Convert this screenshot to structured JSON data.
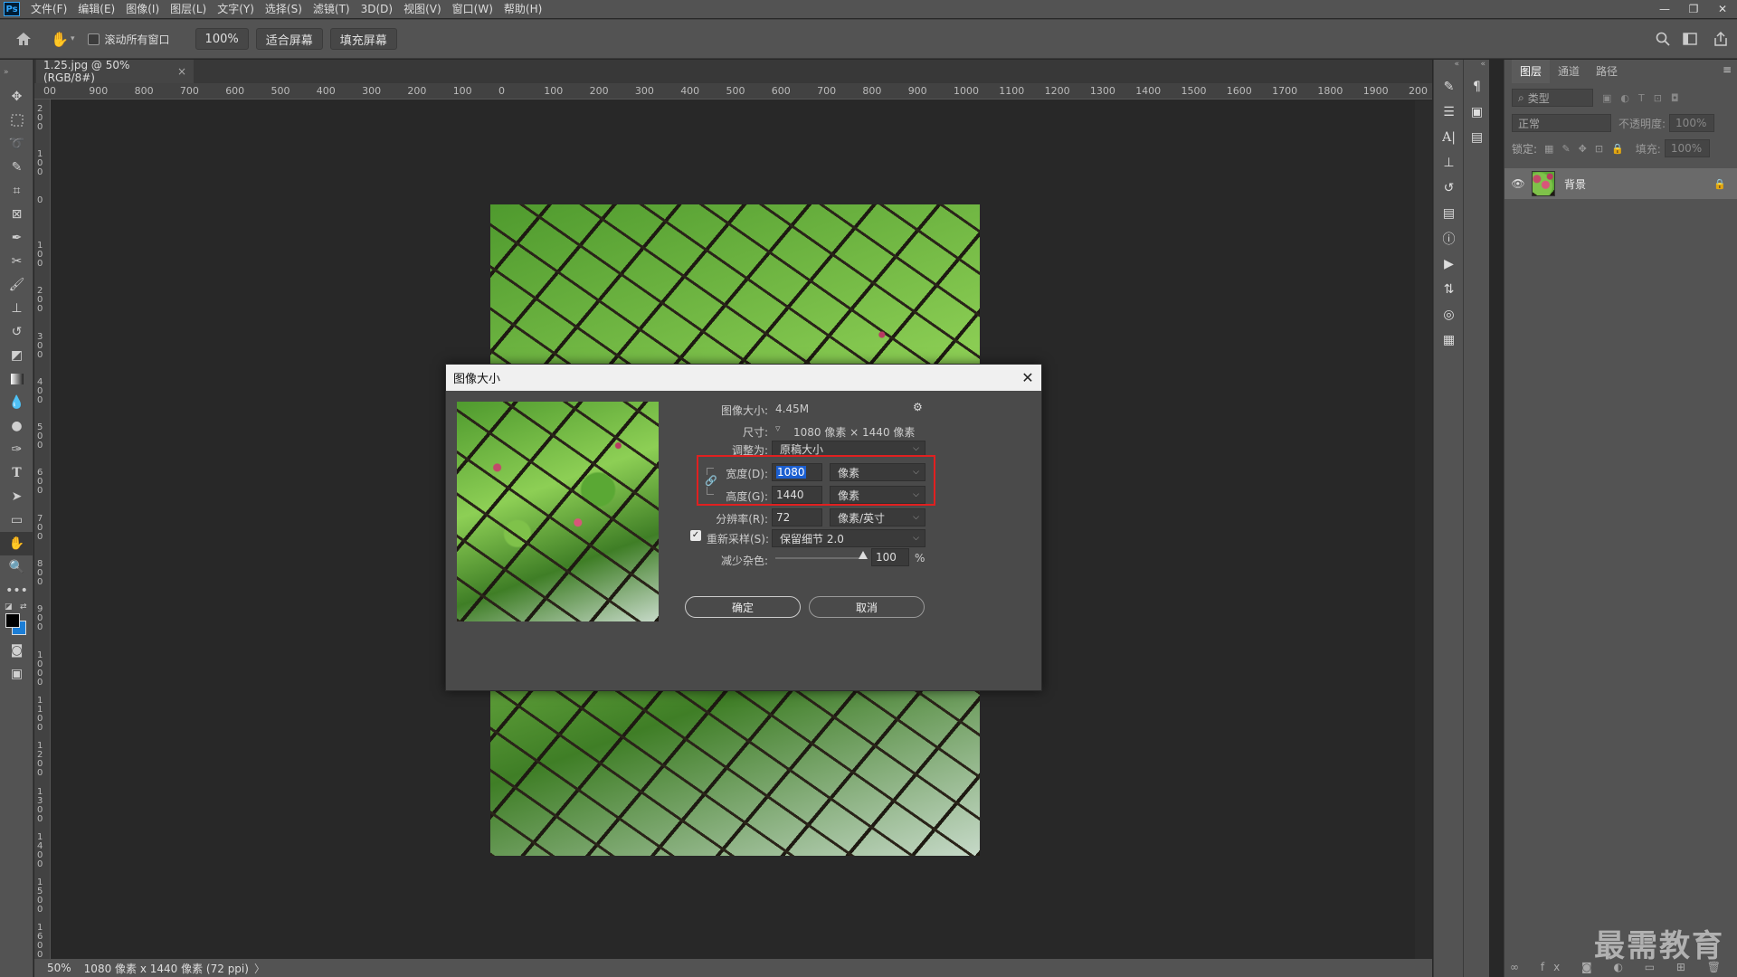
{
  "menubar": {
    "logo": "Ps",
    "items": [
      "文件(F)",
      "编辑(E)",
      "图像(I)",
      "图层(L)",
      "文字(Y)",
      "选择(S)",
      "滤镜(T)",
      "3D(D)",
      "视图(V)",
      "窗口(W)",
      "帮助(H)"
    ],
    "window_controls": [
      "—",
      "❐",
      "✕"
    ]
  },
  "options": {
    "scroll_all_label": "滚动所有窗口",
    "zoom_button": "100%",
    "fit_screen_button": "适合屏幕",
    "fill_screen_button": "填充屏幕"
  },
  "document": {
    "tab_title": "1.25.jpg @ 50%(RGB/8#)",
    "tab_close": "×"
  },
  "ruler": {
    "h_labels": [
      "00",
      "900",
      "800",
      "700",
      "600",
      "500",
      "400",
      "300",
      "200",
      "100",
      "0",
      "100",
      "200",
      "300",
      "400",
      "500",
      "600",
      "700",
      "800",
      "900",
      "1000",
      "1100",
      "1200",
      "1300",
      "1400",
      "1500",
      "1600",
      "1700",
      "1800",
      "1900",
      "200"
    ],
    "v_labels": [
      "200",
      "100",
      "0",
      "100",
      "200",
      "300",
      "400",
      "500",
      "600",
      "700",
      "800",
      "900",
      "1000",
      "1100",
      "1200",
      "1300",
      "1400",
      "1500",
      "1600"
    ]
  },
  "status": {
    "zoom": "50%",
    "doc_info": "1080 像素 x 1440 像素 (72 ppi)",
    "arrow": "〉"
  },
  "layers_panel": {
    "tabs": [
      "图层",
      "通道",
      "路径"
    ],
    "filter_placeholder": "类型",
    "blend_mode": "正常",
    "opacity_label": "不透明度:",
    "opacity_value": "100%",
    "lock_label": "锁定:",
    "fill_label": "填充:",
    "fill_value": "100%",
    "layer_name": "背景"
  },
  "dialog": {
    "title": "图像大小",
    "close": "✕",
    "image_size_label": "图像大小:",
    "image_size_value": "4.45M",
    "dimensions_label": "尺寸:",
    "dimensions_value": "1080 像素  ×  1440 像素",
    "fit_to_label": "调整为:",
    "fit_to_value": "原稿大小",
    "width_label": "宽度(D):",
    "width_value": "1080",
    "width_unit": "像素",
    "height_label": "高度(G):",
    "height_value": "1440",
    "height_unit": "像素",
    "resolution_label": "分辨率(R):",
    "resolution_value": "72",
    "resolution_unit": "像素/英寸",
    "resample_label": "重新采样(S):",
    "resample_value": "保留细节 2.0",
    "resample_checked": true,
    "noise_label": "减少杂色:",
    "noise_value": "100",
    "noise_percent": "%",
    "ok": "确定",
    "cancel": "取消",
    "highlight_color": "#e02020"
  },
  "watermark": "最需教育"
}
